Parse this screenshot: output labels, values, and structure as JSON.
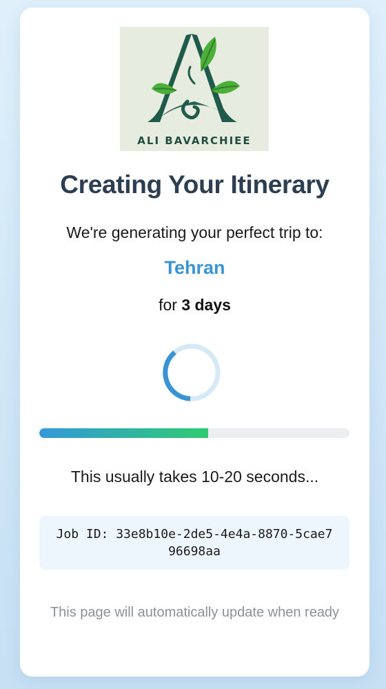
{
  "logo": {
    "brand_text": "ALI BAVARCHIEE",
    "icon": "leaf-letter-a-logo",
    "colors": {
      "letter": "#1f5a4a",
      "leaf": "#4caf3a",
      "background": "#e7ece0"
    }
  },
  "header": {
    "title": "Creating Your Itinerary"
  },
  "trip": {
    "intro": "We're generating your perfect trip to:",
    "destination": "Tehran",
    "duration_prefix": "for",
    "duration_value": "3 days"
  },
  "status": {
    "spinner_icon": "loading-spinner-icon",
    "progress_fraction": 0.545,
    "hint": "This usually takes 10-20 seconds..."
  },
  "job": {
    "label": "Job ID: 33e8b10e-2de5-4e4a-8870-5cae796698aa"
  },
  "footer": {
    "note": "This page will automatically update when ready"
  },
  "colors": {
    "title": "#2c3e50",
    "accent": "#3a93d3",
    "progress_start": "#3498db",
    "progress_end": "#2ecc71",
    "muted": "#8a9299"
  }
}
